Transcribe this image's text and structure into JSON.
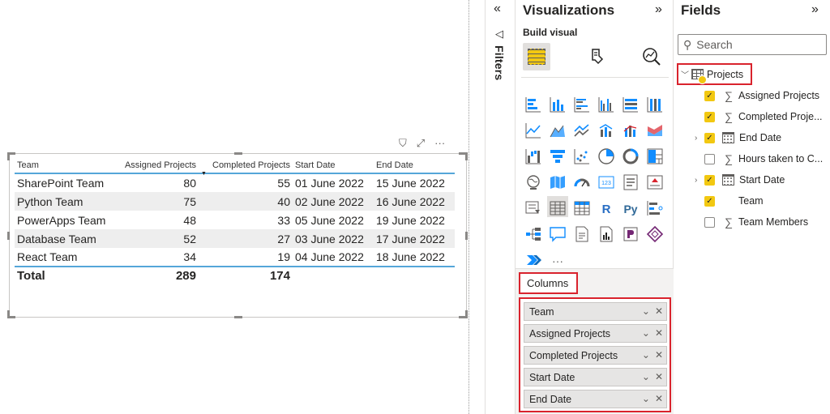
{
  "table_visual": {
    "columns": [
      "Team",
      "Assigned Projects",
      "Completed Projects",
      "Start Date",
      "End Date"
    ],
    "rows": [
      [
        "SharePoint Team",
        "80",
        "55",
        "01 June 2022",
        "15 June 2022"
      ],
      [
        "Python Team",
        "75",
        "40",
        "02 June 2022",
        "16 June 2022"
      ],
      [
        "PowerApps Team",
        "48",
        "33",
        "05 June 2022",
        "19 June 2022"
      ],
      [
        "Database Team",
        "52",
        "27",
        "03 June 2022",
        "17 June 2022"
      ],
      [
        "React Team",
        "34",
        "19",
        "04 June 2022",
        "18 June 2022"
      ]
    ],
    "total": {
      "label": "Total",
      "assigned": "289",
      "completed": "174"
    },
    "header_icons": {
      "filter": "⛉",
      "focus": "⤢",
      "more": "···"
    }
  },
  "filters_pane": {
    "label": "Filters",
    "collapse_icon": "«"
  },
  "visualizations_pane": {
    "title": "Visualizations",
    "expand_icon": "»",
    "build_visual_label": "Build visual",
    "more_visuals": "···",
    "columns_label": "Columns",
    "wells": [
      "Team",
      "Assigned Projects",
      "Completed Projects",
      "Start Date",
      "End Date"
    ],
    "well_chevron": "⌄",
    "well_close": "✕"
  },
  "fields_pane": {
    "title": "Fields",
    "expand_icon": "»",
    "search_placeholder": "Search",
    "table_name": "Projects",
    "fields": [
      {
        "label": "Assigned Projects",
        "checked": true,
        "type": "sigma",
        "expandable": false
      },
      {
        "label": "Completed Proje...",
        "checked": true,
        "type": "sigma",
        "expandable": false
      },
      {
        "label": "End Date",
        "checked": true,
        "type": "calendar",
        "expandable": true
      },
      {
        "label": "Hours taken to C...",
        "checked": false,
        "type": "sigma",
        "expandable": false
      },
      {
        "label": "Start Date",
        "checked": true,
        "type": "calendar",
        "expandable": true
      },
      {
        "label": "Team",
        "checked": true,
        "type": "none",
        "expandable": false
      },
      {
        "label": "Team Members",
        "checked": false,
        "type": "sigma",
        "expandable": false
      }
    ]
  },
  "colors": {
    "accent_yellow": "#f2c811",
    "highlight_red": "#d9232d",
    "table_rule_blue": "#55a6d9"
  }
}
